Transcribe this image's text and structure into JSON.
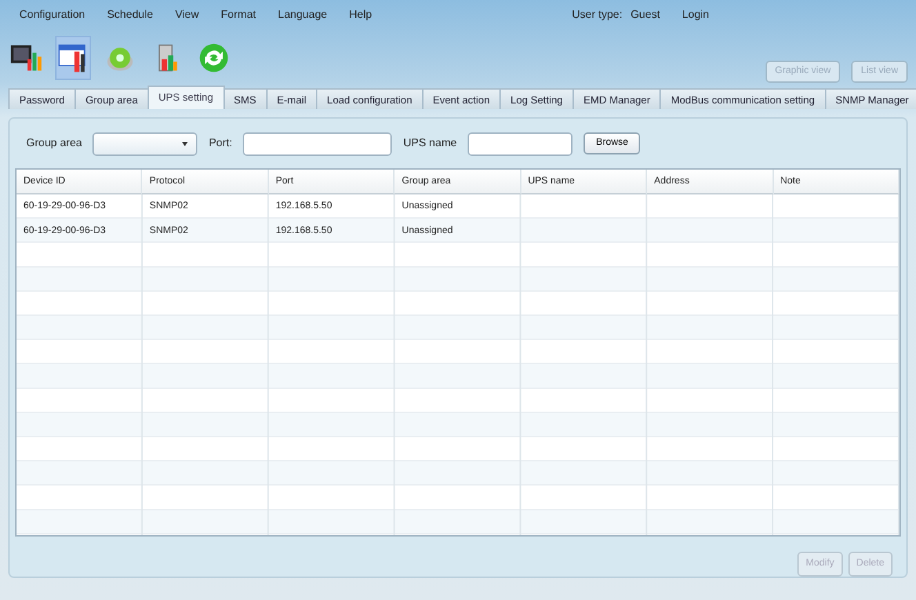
{
  "menu": [
    "Configuration",
    "Schedule",
    "View",
    "Format",
    "Language",
    "Help"
  ],
  "user": {
    "label": "User type:",
    "value": "Guest",
    "login": "Login"
  },
  "toolbar": [
    {
      "kind": "monitor",
      "selected": false
    },
    {
      "kind": "tools",
      "selected": true
    },
    {
      "kind": "disc",
      "selected": false
    },
    {
      "kind": "ups",
      "selected": false
    },
    {
      "kind": "refresh",
      "selected": false
    }
  ],
  "view_buttons": [
    {
      "label": "Graphic view",
      "disabled": true
    },
    {
      "label": "List view",
      "disabled": true
    }
  ],
  "tabs": [
    {
      "label": "Password",
      "selected": false
    },
    {
      "label": "Group area",
      "selected": false
    },
    {
      "label": "UPS setting",
      "selected": true
    },
    {
      "label": "SMS",
      "selected": false
    },
    {
      "label": "E-mail",
      "selected": false
    },
    {
      "label": "Load configuration",
      "selected": false
    },
    {
      "label": "Event action",
      "selected": false
    },
    {
      "label": "Log Setting",
      "selected": false
    },
    {
      "label": "EMD Manager",
      "selected": false
    },
    {
      "label": "ModBus communication setting",
      "selected": false
    },
    {
      "label": "SNMP Manager",
      "selected": false
    }
  ],
  "filter": {
    "group_label": "Group area",
    "port_label": "Port:",
    "ups_label": "UPS name",
    "browse": "Browse"
  },
  "table": {
    "columns": [
      "Device ID",
      "Protocol",
      "Port",
      "Group area",
      "UPS name",
      "Address",
      "Note"
    ],
    "rows": [
      [
        "60-19-29-00-96-D3",
        "SNMP02",
        "192.168.5.50",
        "Unassigned",
        "",
        "",
        ""
      ],
      [
        "60-19-29-00-96-D3",
        "SNMP02",
        "192.168.5.50",
        "Unassigned",
        "",
        "",
        ""
      ]
    ]
  },
  "actions": [
    {
      "label": "Modify",
      "disabled": true
    },
    {
      "label": "Delete",
      "disabled": true
    }
  ]
}
